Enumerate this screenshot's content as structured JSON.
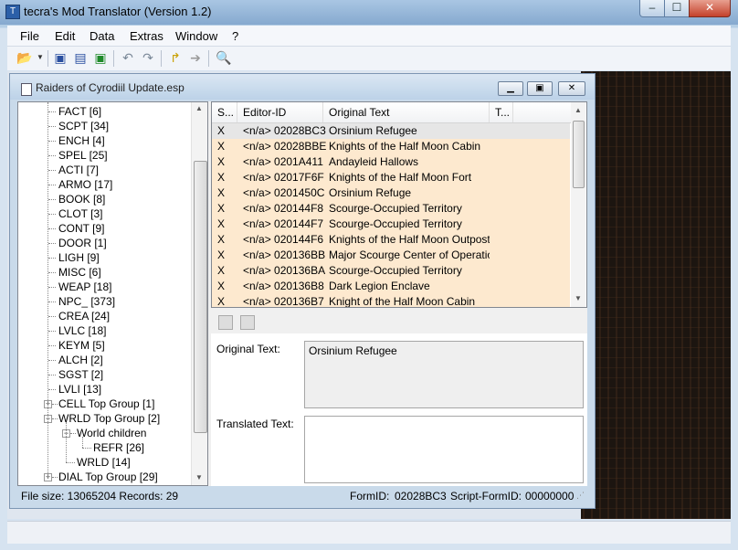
{
  "app": {
    "title": "tecra's Mod Translator (Version 1.2)"
  },
  "window_controls": {
    "minimize": "‒",
    "maximize": "☐",
    "close": "✕"
  },
  "menu": [
    "File",
    "Edit",
    "Data",
    "Extras",
    "Window",
    "?"
  ],
  "child": {
    "title": "Raiders of Cyrodiil Update.esp",
    "controls": {
      "minimize": "▁",
      "maximize": "▣",
      "close": "✕"
    }
  },
  "tree": {
    "items": [
      {
        "label": "FACT [6]"
      },
      {
        "label": "SCPT [34]"
      },
      {
        "label": "ENCH [4]"
      },
      {
        "label": "SPEL [25]"
      },
      {
        "label": "ACTI [7]"
      },
      {
        "label": "ARMO [17]"
      },
      {
        "label": "BOOK [8]"
      },
      {
        "label": "CLOT [3]"
      },
      {
        "label": "CONT [9]"
      },
      {
        "label": "DOOR [1]"
      },
      {
        "label": "LIGH [9]"
      },
      {
        "label": "MISC [6]"
      },
      {
        "label": "WEAP [18]"
      },
      {
        "label": "NPC_ [373]"
      },
      {
        "label": "CREA [24]"
      },
      {
        "label": "LVLC [18]"
      },
      {
        "label": "KEYM [5]"
      },
      {
        "label": "ALCH [2]"
      },
      {
        "label": "SGST [2]"
      },
      {
        "label": "LVLI [13]"
      }
    ],
    "cell_group": "CELL Top Group [1]",
    "wrld_group": "WRLD Top Group [2]",
    "world_children": "World children",
    "refr": "REFR [26]",
    "wrld": "WRLD [14]",
    "dial_group": "DIAL Top Group [29]",
    "expand_plus": "+",
    "expand_minus": "−"
  },
  "list": {
    "columns": [
      "S...",
      "Editor-ID",
      "Original Text",
      "T..."
    ],
    "rows": [
      {
        "s": "X",
        "id": "<n/a> 02028BC3",
        "text": "Orsinium Refugee"
      },
      {
        "s": "X",
        "id": "<n/a> 02028BBE",
        "text": "Knights of the Half Moon Cabin"
      },
      {
        "s": "X",
        "id": "<n/a> 0201A411",
        "text": "Andayleid Hallows"
      },
      {
        "s": "X",
        "id": "<n/a> 02017F6F",
        "text": "Knights of the Half Moon Fort"
      },
      {
        "s": "X",
        "id": "<n/a> 0201450C",
        "text": "Orsinium Refuge"
      },
      {
        "s": "X",
        "id": "<n/a> 020144F8",
        "text": "Scourge-Occupied Territory"
      },
      {
        "s": "X",
        "id": "<n/a> 020144F7",
        "text": "Scourge-Occupied Territory"
      },
      {
        "s": "X",
        "id": "<n/a> 020144F6",
        "text": "Knights of the Half Moon Outpost"
      },
      {
        "s": "X",
        "id": "<n/a> 020136BB",
        "text": "Major Scourge Center of Operations"
      },
      {
        "s": "X",
        "id": "<n/a> 020136BA",
        "text": "Scourge-Occupied Territory"
      },
      {
        "s": "X",
        "id": "<n/a> 020136B8",
        "text": "Dark Legion Enclave"
      },
      {
        "s": "X",
        "id": "<n/a> 020136B7",
        "text": "Knight of the Half Moon Cabin"
      }
    ]
  },
  "detail": {
    "original_label": "Original Text:",
    "original_value": "Orsinium Refugee",
    "translated_label": "Translated Text:",
    "translated_value": ""
  },
  "status": {
    "file_info": "File size: 13065204 Records: 29",
    "formid_label": "FormID:",
    "formid_value": "02028BC3",
    "script_formid_label": "Script-FormID:",
    "script_formid_value": "00000000"
  }
}
